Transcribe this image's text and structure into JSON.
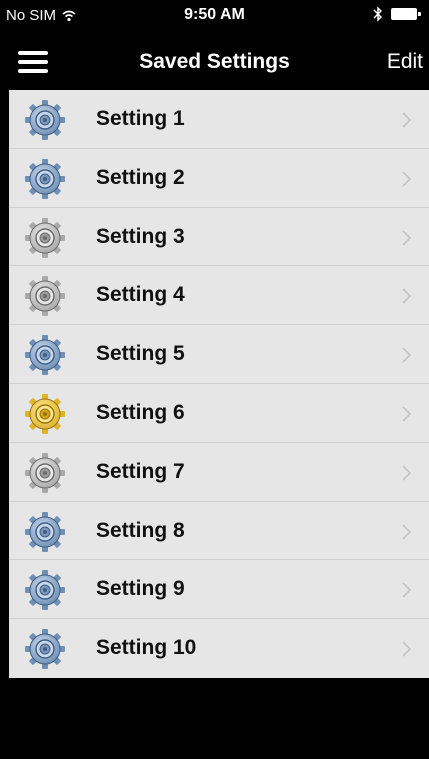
{
  "status_bar": {
    "carrier": "No SIM",
    "time": "9:50 AM"
  },
  "nav": {
    "title": "Saved Settings",
    "edit_label": "Edit"
  },
  "colors": {
    "blue_gear": "#5d7fa6",
    "gray_gear": "#9a9a9a",
    "gold_gear": "#d4a51c",
    "list_bg": "#e6e6e6"
  },
  "settings": [
    {
      "label": "Setting 1",
      "icon": "blue"
    },
    {
      "label": "Setting 2",
      "icon": "blue"
    },
    {
      "label": "Setting 3",
      "icon": "gray"
    },
    {
      "label": "Setting 4",
      "icon": "gray"
    },
    {
      "label": "Setting 5",
      "icon": "blue"
    },
    {
      "label": "Setting 6",
      "icon": "gold"
    },
    {
      "label": "Setting 7",
      "icon": "gray"
    },
    {
      "label": "Setting 8",
      "icon": "blue"
    },
    {
      "label": "Setting 9",
      "icon": "blue"
    },
    {
      "label": "Setting 10",
      "icon": "blue"
    }
  ]
}
